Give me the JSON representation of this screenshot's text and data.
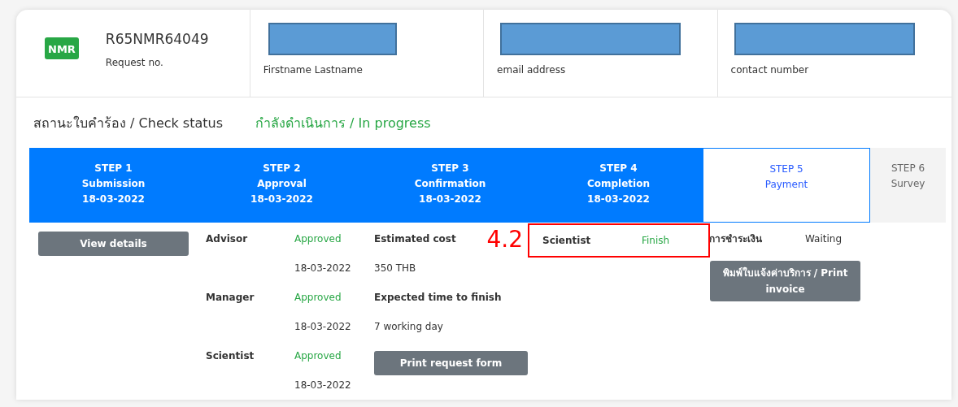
{
  "header": {
    "badge": "NMR",
    "request_no": "R65NMR64049",
    "request_label": "Request no.",
    "fields": [
      {
        "label": "Firstname Lastname",
        "redacted": true
      },
      {
        "label": "email address",
        "redacted": true
      },
      {
        "label": "contact number",
        "redacted": true
      }
    ]
  },
  "status": {
    "label": "สถานะใบคำร้อง / Check status",
    "value": "กำลังดำเนินการ / In progress"
  },
  "steps": [
    {
      "step": "STEP 1",
      "name": "Submission",
      "date": "18-03-2022",
      "completed": true,
      "selected": false
    },
    {
      "step": "STEP 2",
      "name": "Approval",
      "date": "18-03-2022",
      "completed": true,
      "selected": false
    },
    {
      "step": "STEP 3",
      "name": "Confirmation",
      "date": "18-03-2022",
      "completed": true,
      "selected": false
    },
    {
      "step": "STEP 4",
      "name": "Completion",
      "date": "18-03-2022",
      "completed": true,
      "selected": false
    },
    {
      "step": "STEP 5",
      "name": "Payment",
      "completed": false,
      "selected": true
    },
    {
      "step": "STEP 6",
      "name": "Survey",
      "completed": false,
      "selected": false
    }
  ],
  "details_button": "View details",
  "approvals": [
    {
      "role": "Advisor",
      "status": "Approved",
      "date": "18-03-2022"
    },
    {
      "role": "Manager",
      "status": "Approved",
      "date": "18-03-2022"
    },
    {
      "role": "Scientist",
      "status": "Approved",
      "date": "18-03-2022"
    }
  ],
  "estimates": [
    {
      "label": "Estimated cost",
      "value": "350 THB"
    },
    {
      "label": "Expected time to finish",
      "value": "7 working day"
    }
  ],
  "print_request_button": "Print request form",
  "completion": {
    "role": "Scientist",
    "status": "Finish",
    "annotation": "4.2",
    "highlighted": true
  },
  "payment": {
    "label": "การชำระเงิน",
    "status": "Waiting",
    "button": "พิมพ์ใบแจ้งค่าบริการ / Print invoice"
  }
}
